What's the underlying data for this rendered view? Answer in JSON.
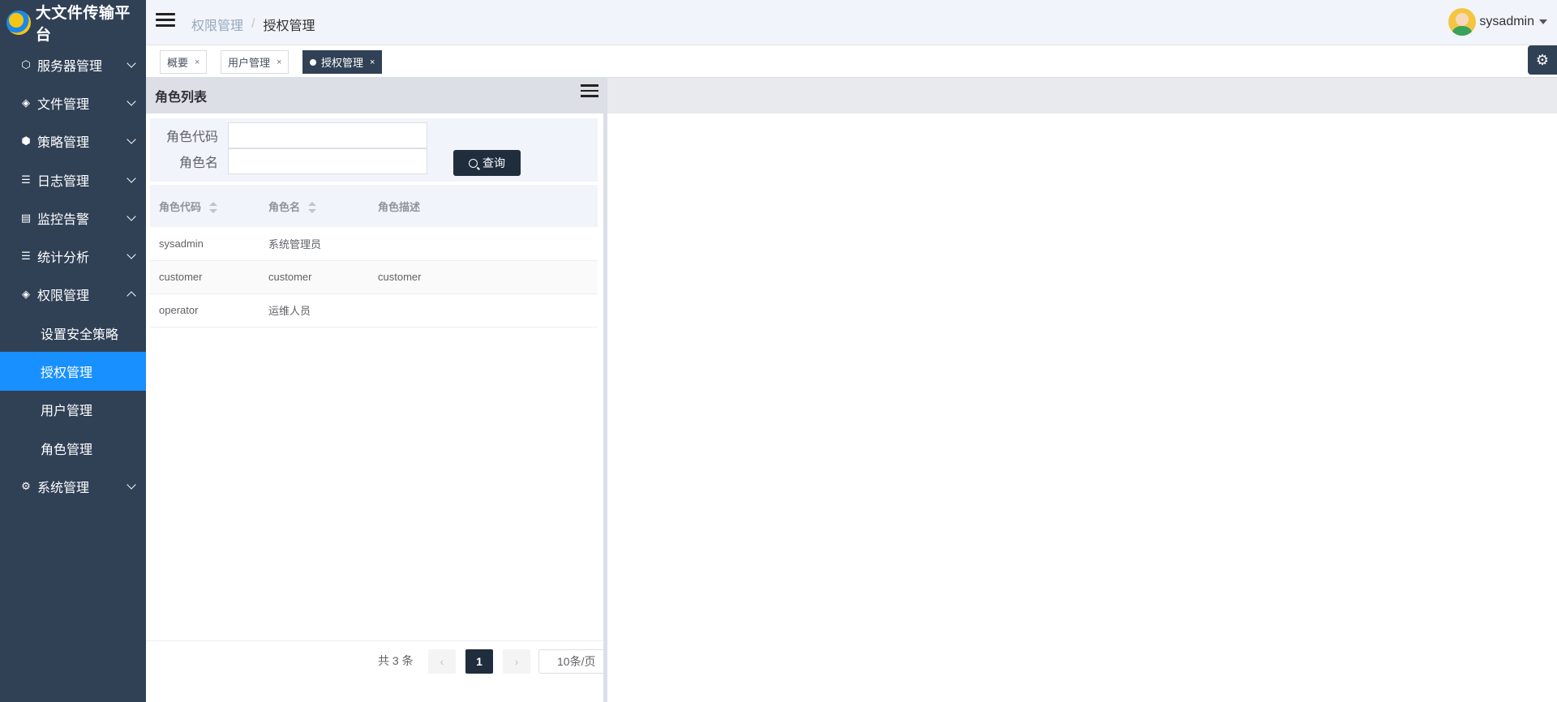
{
  "app": {
    "title": "大文件传输平台"
  },
  "sidebar": {
    "items": [
      {
        "label": "服务器管理",
        "icon": "cube-icon",
        "expanded": false
      },
      {
        "label": "文件管理",
        "icon": "layers-icon",
        "expanded": false
      },
      {
        "label": "策略管理",
        "icon": "cubes-icon",
        "expanded": false
      },
      {
        "label": "日志管理",
        "icon": "list-icon",
        "expanded": false
      },
      {
        "label": "监控告警",
        "icon": "monitor-icon",
        "expanded": false
      },
      {
        "label": "统计分析",
        "icon": "list-icon",
        "expanded": false
      },
      {
        "label": "权限管理",
        "icon": "layers-icon",
        "expanded": true
      },
      {
        "label": "系统管理",
        "icon": "gear-icon",
        "expanded": false
      }
    ],
    "sub_items": [
      {
        "label": "设置安全策略",
        "active": false
      },
      {
        "label": "授权管理",
        "active": true
      },
      {
        "label": "用户管理",
        "active": false
      },
      {
        "label": "角色管理",
        "active": false
      }
    ]
  },
  "header": {
    "breadcrumb": [
      "权限管理",
      "授权管理"
    ],
    "separator": "/",
    "user": "sysadmin"
  },
  "tags": [
    {
      "label": "概要",
      "close": "×",
      "active": false
    },
    {
      "label": "用户管理",
      "close": "×",
      "active": false
    },
    {
      "label": "授权管理",
      "close": "×",
      "active": true
    }
  ],
  "role_panel": {
    "title": "角色列表",
    "search": {
      "code_label": "角色代码",
      "code_value": "",
      "name_label": "角色名",
      "name_value": "",
      "query_label": "查询"
    },
    "columns": [
      "角色代码",
      "角色名",
      "角色描述"
    ],
    "rows": [
      [
        "sysadmin",
        "系统管理员",
        ""
      ],
      [
        "customer",
        "customer",
        "customer"
      ],
      [
        "operator",
        "运维人员",
        ""
      ]
    ],
    "pagination": {
      "total_text": "共 3 条",
      "current_page": "1",
      "prev": "‹",
      "next": "›",
      "page_size": "10条/页"
    }
  },
  "colors": {
    "sidebar_bg": "#304156",
    "active_menu": "#1890ff",
    "dark_button": "#1f2d3d"
  }
}
